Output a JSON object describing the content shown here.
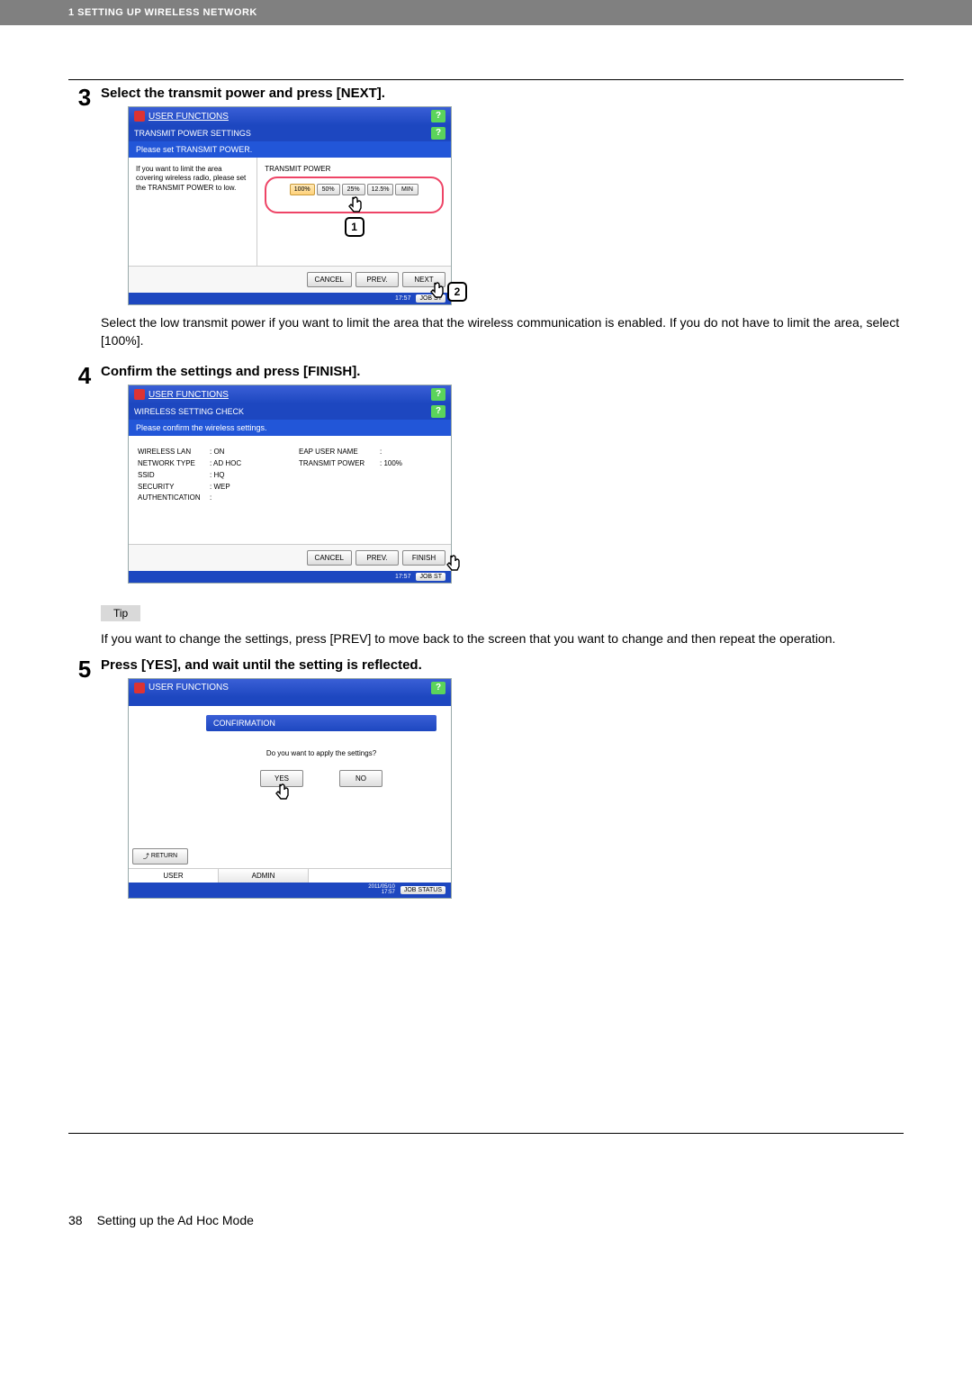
{
  "header": {
    "chapter": "1 SETTING UP WIRELESS NETWORK"
  },
  "steps": {
    "s3": {
      "num": "3",
      "title": "Select the transmit power and press [NEXT].",
      "after_text": "Select the low transmit power if you want to limit the area that the wireless communication is enabled. If you do not have to limit the area, select [100%]."
    },
    "s4": {
      "num": "4",
      "title": "Confirm the settings and press [FINISH]."
    },
    "s5": {
      "num": "5",
      "title": "Press [YES], and wait until the setting is reflected."
    }
  },
  "tip": {
    "label": "Tip",
    "text": "If you want to change the settings, press [PREV] to move back to the screen that you want to change and then repeat the operation."
  },
  "panel1": {
    "titlebar": "USER FUNCTIONS",
    "subbar": "TRANSMIT POWER SETTINGS",
    "bluebar": "Please set TRANSMIT POWER.",
    "left_text": "If you want to limit the area covering wireless radio, please set the TRANSMIT POWER to low.",
    "tp_label": "TRANSMIT POWER",
    "options": [
      "100%",
      "50%",
      "25%",
      "12.5%",
      "MIN"
    ],
    "buttons": {
      "cancel": "CANCEL",
      "prev": "PREV.",
      "next": "NEXT"
    },
    "time": "17:57",
    "job_status": "JOB ST",
    "callout1": "1",
    "callout2": "2"
  },
  "panel2": {
    "titlebar": "USER FUNCTIONS",
    "subbar": "WIRELESS SETTING CHECK",
    "bluebar": "Please confirm the wireless settings.",
    "left_rows": [
      {
        "k": "WIRELESS LAN",
        "v": ": ON"
      },
      {
        "k": "NETWORK TYPE",
        "v": ": AD HOC"
      },
      {
        "k": "SSID",
        "v": ": HQ"
      },
      {
        "k": "SECURITY",
        "v": ": WEP"
      },
      {
        "k": "AUTHENTICATION",
        "v": ":"
      }
    ],
    "right_rows": [
      {
        "k": "EAP USER NAME",
        "v": ":"
      },
      {
        "k": "TRANSMIT POWER",
        "v": ": 100%"
      }
    ],
    "buttons": {
      "cancel": "CANCEL",
      "prev": "PREV.",
      "finish": "FINISH"
    },
    "time": "17:57",
    "job_status": "JOB ST"
  },
  "panel3": {
    "titlebar": "USER FUNCTIONS",
    "conf_header": "CONFIRMATION",
    "conf_text": "Do you want to apply the settings?",
    "yes": "YES",
    "no": "NO",
    "return": "RETURN",
    "tabs": {
      "user": "USER",
      "admin": "ADMIN"
    },
    "datetime": "2011/05/10\n17:57",
    "job_status": "JOB STATUS"
  },
  "footer": {
    "page": "38",
    "section": "Setting up the Ad Hoc Mode"
  }
}
